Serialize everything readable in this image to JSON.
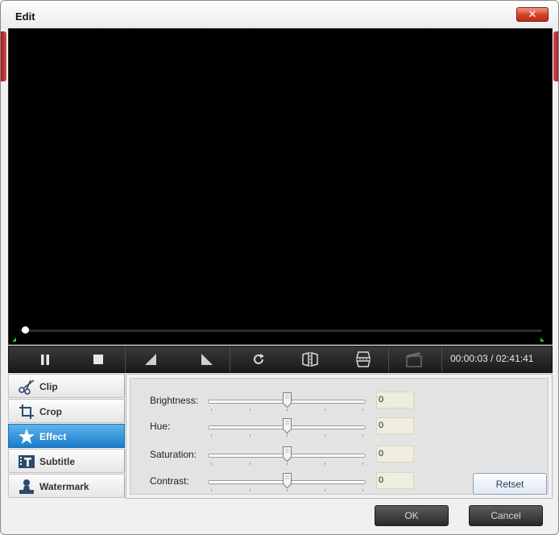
{
  "window": {
    "title": "Edit",
    "close_glyph": "✕"
  },
  "colors": {
    "accent": "#1b7ccc",
    "close": "#d8442e",
    "marker": "#39c436"
  },
  "player": {
    "timecode": "00:00:03 / 02:41:41",
    "progress": 0.01
  },
  "toolbar": {
    "icons": [
      "pause-icon",
      "stop-icon",
      "mark-in-icon",
      "mark-out-icon",
      "rotate-icon",
      "flip-horizontal-icon",
      "flip-vertical-icon",
      "snapshot-icon"
    ]
  },
  "tabs": [
    {
      "label": "Clip",
      "icon": "scissors-icon",
      "active": false
    },
    {
      "label": "Crop",
      "icon": "crop-icon",
      "active": false
    },
    {
      "label": "Effect",
      "icon": "star-icon",
      "active": true
    },
    {
      "label": "Subtitle",
      "icon": "subtitle-icon",
      "active": false
    },
    {
      "label": "Watermark",
      "icon": "watermark-icon",
      "active": false
    }
  ],
  "effect": {
    "sliders": [
      {
        "label": "Brightness:",
        "value": "0",
        "level": 0.5
      },
      {
        "label": "Hue:",
        "value": "0",
        "level": 0.5
      },
      {
        "label": "Saturation:",
        "value": "0",
        "level": 0.5
      },
      {
        "label": "Contrast:",
        "value": "0",
        "level": 0.5
      }
    ],
    "reset_label": "Retset"
  },
  "footer": {
    "ok_label": "OK",
    "cancel_label": "Cancel"
  }
}
